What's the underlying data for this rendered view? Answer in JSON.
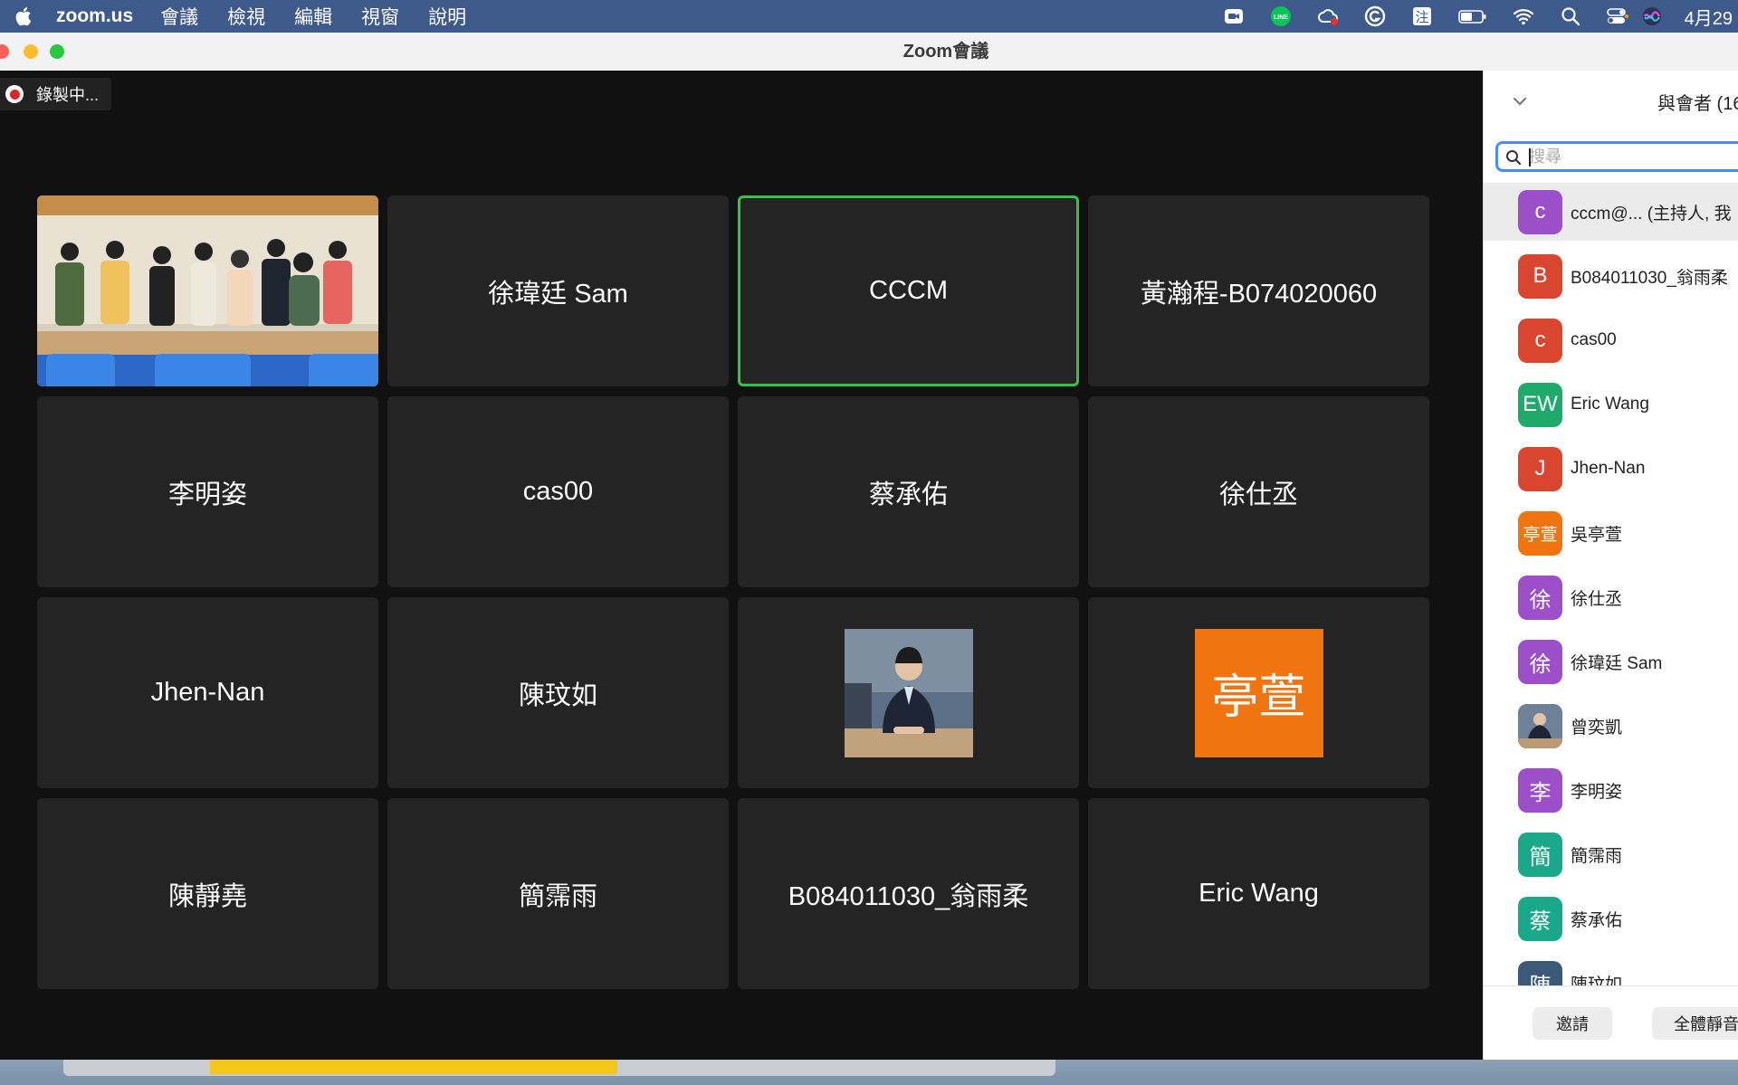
{
  "menubar": {
    "app_name": "zoom.us",
    "items": [
      "會議",
      "檢視",
      "編輯",
      "視窗",
      "說明"
    ],
    "status_icons": [
      "zoom-camera-icon",
      "line-icon",
      "creative-cloud-icon",
      "grammarly-icon",
      "input-method-icon",
      "battery-icon",
      "wifi-icon",
      "spotlight-search-icon",
      "control-center-icon",
      "siri-icon"
    ],
    "input_method_label": "注",
    "line_label": "LINE",
    "clock": "4月29"
  },
  "window": {
    "title": "Zoom會議",
    "recording_label": "錄製中..."
  },
  "gallery": [
    {
      "name": "",
      "type": "video-group",
      "active": false
    },
    {
      "name": "徐瑋廷 Sam",
      "type": "name",
      "active": false
    },
    {
      "name": "CCCM",
      "type": "name",
      "active": true
    },
    {
      "name": "黃瀚程-B074020060",
      "type": "name",
      "active": false
    },
    {
      "name": "李明姿",
      "type": "name",
      "active": false
    },
    {
      "name": "cas00",
      "type": "name",
      "active": false
    },
    {
      "name": "蔡承佑",
      "type": "name",
      "active": false
    },
    {
      "name": "徐仕丞",
      "type": "name",
      "active": false
    },
    {
      "name": "Jhen-Nan",
      "type": "name",
      "active": false
    },
    {
      "name": "陳玟如",
      "type": "name",
      "active": false
    },
    {
      "name": "",
      "type": "profile-photo",
      "active": false
    },
    {
      "name": "亭萱",
      "type": "avatar-orange",
      "active": false
    },
    {
      "name": "陳靜堯",
      "type": "name",
      "active": false
    },
    {
      "name": "簡霈雨",
      "type": "name",
      "active": false
    },
    {
      "name": "B084011030_翁雨柔",
      "type": "name",
      "active": false
    },
    {
      "name": "Eric Wang",
      "type": "name",
      "active": false
    }
  ],
  "participants_panel": {
    "title": "與會者 (16",
    "search_placeholder": "搜尋",
    "participants": [
      {
        "initials": "c",
        "name": "cccm@...  (主持人, 我",
        "color": "#9b4fc9",
        "highlight": true
      },
      {
        "initials": "B",
        "name": "B084011030_翁雨柔",
        "color": "#d9452f"
      },
      {
        "initials": "c",
        "name": "cas00",
        "color": "#d9452f"
      },
      {
        "initials": "EW",
        "name": "Eric Wang",
        "color": "#1faa6b"
      },
      {
        "initials": "J",
        "name": "Jhen-Nan",
        "color": "#d9452f"
      },
      {
        "initials": "亭萱",
        "name": "吳亭萱",
        "color": "#f07410",
        "small": true
      },
      {
        "initials": "徐",
        "name": "徐仕丞",
        "color": "#9b4fc9"
      },
      {
        "initials": "徐",
        "name": "徐瑋廷 Sam",
        "color": "#9b4fc9"
      },
      {
        "initials": "",
        "name": "曾奕凱",
        "color": "#444",
        "photo": true
      },
      {
        "initials": "李",
        "name": "李明姿",
        "color": "#9b4fc9"
      },
      {
        "initials": "簡",
        "name": "簡霈雨",
        "color": "#1aa88a"
      },
      {
        "initials": "蔡",
        "name": "蔡承佑",
        "color": "#1aa88a"
      },
      {
        "initials": "陳",
        "name": "陳玟如",
        "color": "#3b5a7a"
      }
    ],
    "invite_label": "邀請",
    "mute_all_label": "全體靜音"
  },
  "colors": {
    "active_border": "#35c24a",
    "tile_bg": "#242424",
    "orange_avatar": "#f07410"
  }
}
